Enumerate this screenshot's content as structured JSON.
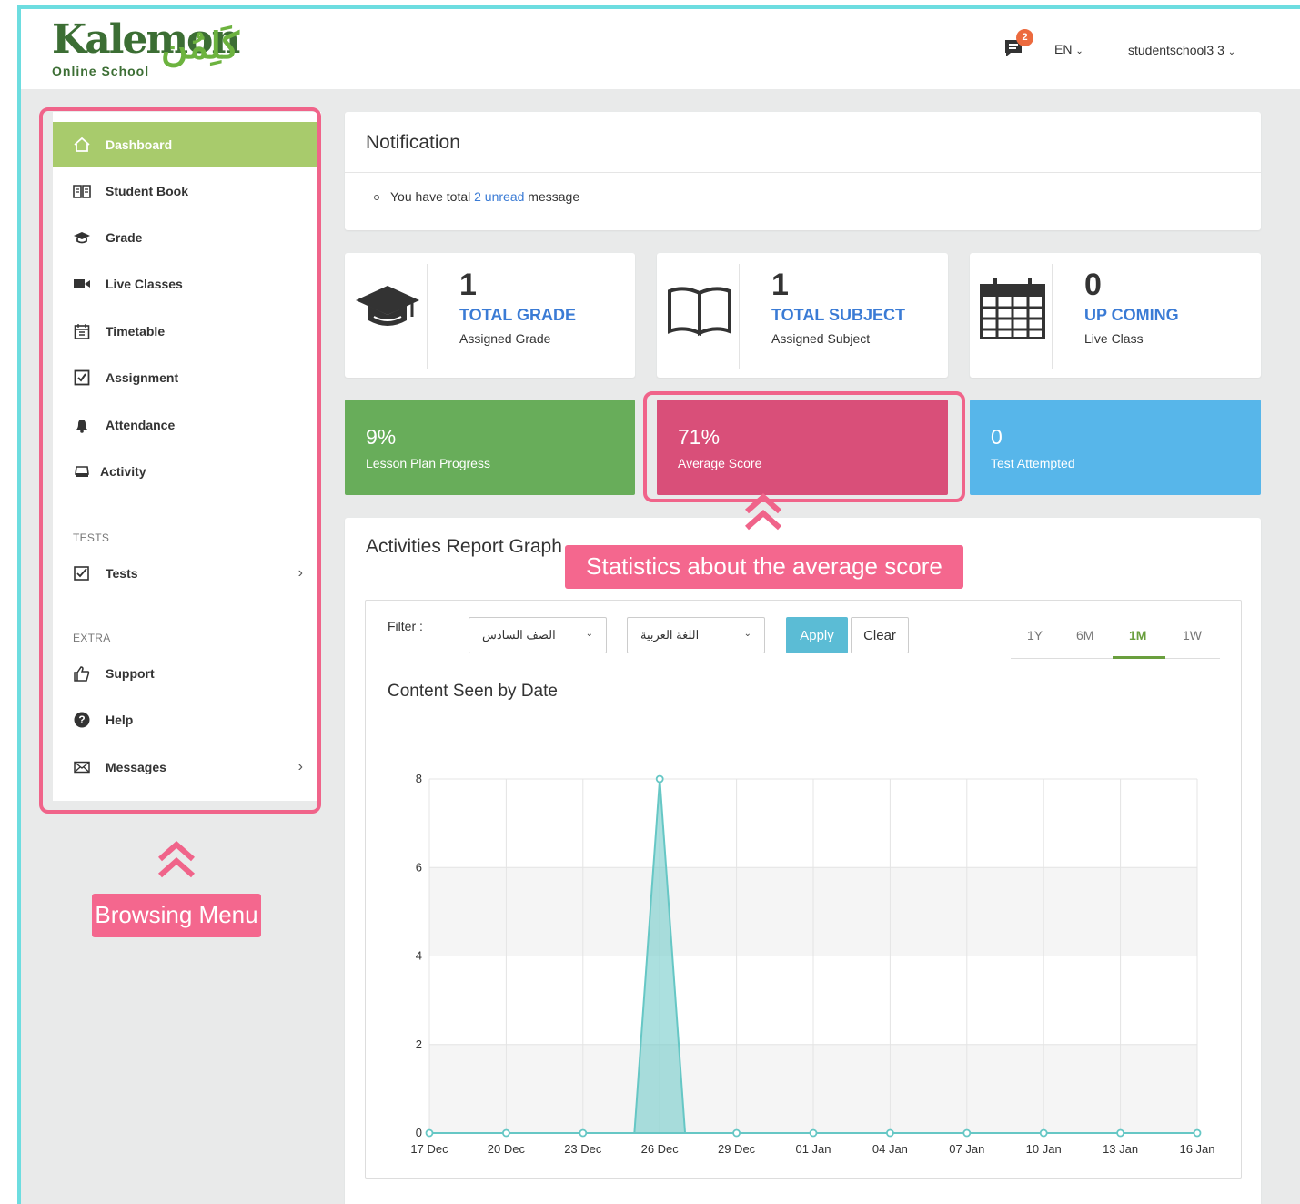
{
  "header": {
    "logo_latin": "Kalemon",
    "logo_sub": "Online School",
    "logo_arabic": "كَلِمُن",
    "chat_badge": "2",
    "language": "EN",
    "user": "studentschool3 3"
  },
  "sidebar": {
    "items": [
      {
        "label": "Dashboard",
        "icon": "home-icon",
        "active": true
      },
      {
        "label": "Student Book",
        "icon": "book-icon"
      },
      {
        "label": "Grade",
        "icon": "graduation-cap-icon"
      },
      {
        "label": "Live Classes",
        "icon": "video-camera-icon"
      },
      {
        "label": "Timetable",
        "icon": "calendar-icon"
      },
      {
        "label": "Assignment",
        "icon": "checkbox-icon"
      },
      {
        "label": "Attendance",
        "icon": "bell-icon"
      },
      {
        "label": "Activity",
        "icon": "inbox-icon"
      }
    ],
    "section_tests": "TESTS",
    "tests_label": "Tests",
    "section_extra": "EXTRA",
    "extra_items": [
      {
        "label": "Support",
        "icon": "thumbs-up-icon"
      },
      {
        "label": "Help",
        "icon": "question-circle-icon"
      },
      {
        "label": "Messages",
        "icon": "envelope-icon"
      }
    ]
  },
  "annotations": {
    "menu_label": "Browsing Menu",
    "score_label": "Statistics about the average score",
    "highlight_color": "#f0648a"
  },
  "notification": {
    "title": "Notification",
    "text_before": "You have total",
    "link": "2 unread",
    "text_after": "message"
  },
  "stats": [
    {
      "number": "1",
      "title": "TOTAL GRADE",
      "sub": "Assigned Grade",
      "icon": "graduation-cap-icon"
    },
    {
      "number": "1",
      "title": "TOTAL SUBJECT",
      "sub": "Assigned Subject",
      "icon": "open-book-icon"
    },
    {
      "number": "0",
      "title": "UP COMING",
      "sub": "Live Class",
      "icon": "calendar-icon"
    }
  ],
  "kpis": [
    {
      "value": "9%",
      "label": "Lesson Plan Progress",
      "color": "#68ad5a"
    },
    {
      "value": "71%",
      "label": "Average Score",
      "color": "#d94f79"
    },
    {
      "value": "0",
      "label": "Test Attempted",
      "color": "#57b6ea"
    }
  ],
  "graph": {
    "title": "Activities Report Graph",
    "filter_label": "Filter :",
    "select_grade": "الصف السادس",
    "select_subject": "اللغة العربية",
    "apply": "Apply",
    "clear": "Clear",
    "ranges": [
      "1Y",
      "6M",
      "1M",
      "1W"
    ],
    "active_range": "1M",
    "chart_title": "Content Seen by Date"
  },
  "chart_data": {
    "type": "area",
    "title": "Content Seen by Date",
    "x": [
      "17 Dec",
      "20 Dec",
      "23 Dec",
      "26 Dec",
      "29 Dec",
      "01 Jan",
      "04 Jan",
      "07 Jan",
      "10 Jan",
      "13 Jan",
      "16 Jan"
    ],
    "series": [
      {
        "values": [
          0,
          0,
          0,
          8,
          0,
          0,
          0,
          0,
          0,
          0,
          0
        ],
        "color": "#66c7c5"
      }
    ],
    "ylim": [
      0,
      8
    ],
    "yticks": [
      0,
      2,
      4,
      6,
      8
    ],
    "grid": true
  }
}
